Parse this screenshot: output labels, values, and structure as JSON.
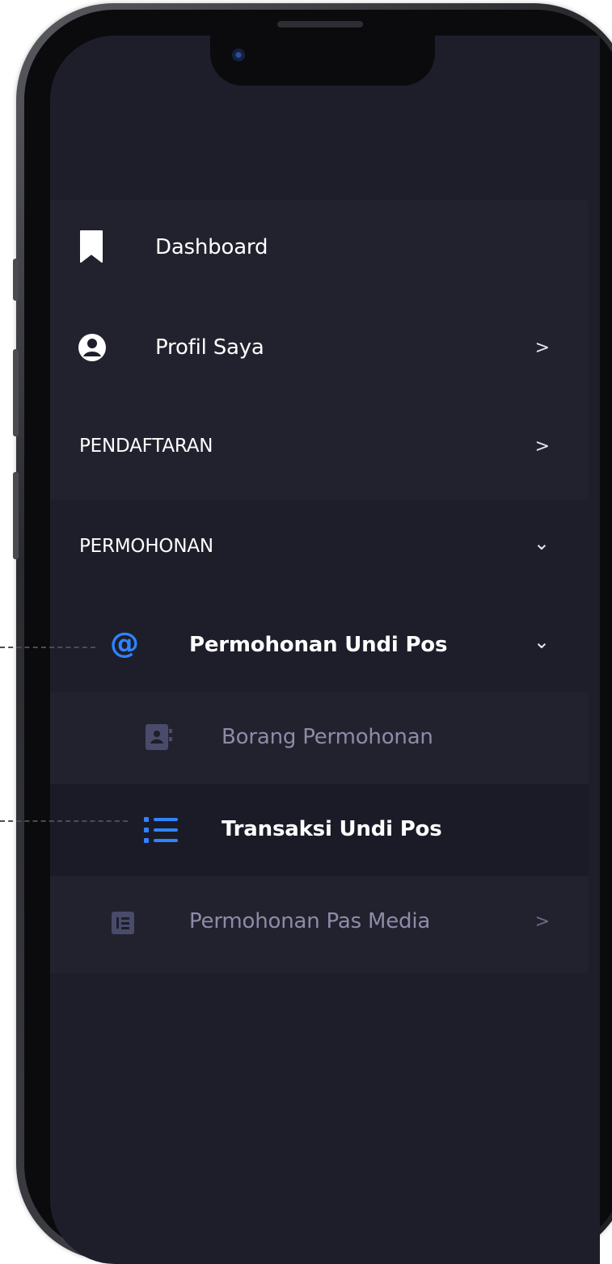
{
  "menu": {
    "items": [
      {
        "label": "Dashboard",
        "icon": "bookmark-icon"
      },
      {
        "label": "Profil Saya",
        "icon": "user-circle-icon",
        "chevron": ">"
      },
      {
        "label": "PENDAFTARAN",
        "chevron": ">"
      },
      {
        "label": "PERMOHONAN",
        "chevron": "⌄"
      }
    ],
    "sub": {
      "label": "Permohonan Undi Pos",
      "icon": "at-sign-icon",
      "chevron": "⌄",
      "children": [
        {
          "label": "Borang Permohonan",
          "icon": "contact-book-icon"
        },
        {
          "label": "Transaksi Undi Pos",
          "icon": "list-icon"
        }
      ]
    },
    "next": {
      "label": "Permohonan Pas Media",
      "icon": "document-icon",
      "chevron": ">"
    }
  },
  "colors": {
    "screen_bg": "#1e1e2b",
    "accent_blue": "#2f84ff",
    "muted_icon": "#4a4a6a",
    "muted_text": "#8c8ca8"
  }
}
